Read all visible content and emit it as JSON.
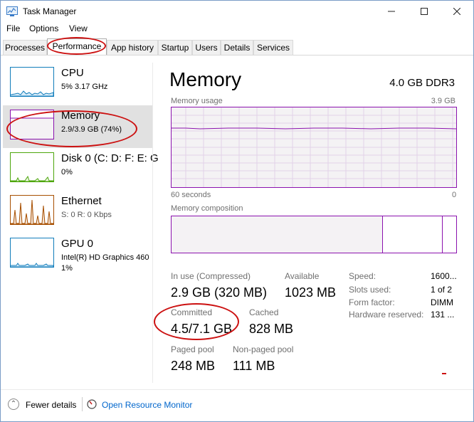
{
  "window": {
    "title": "Task Manager"
  },
  "menu": [
    "File",
    "Options",
    "View"
  ],
  "tabs": [
    "Processes",
    "Performance",
    "App history",
    "Startup",
    "Users",
    "Details",
    "Services"
  ],
  "active_tab": "Performance",
  "resources": [
    {
      "name": "CPU",
      "line1": "5% 3.17 GHz",
      "line2": ""
    },
    {
      "name": "Memory",
      "line1": "2.9/3.9 GB (74%)",
      "line2": ""
    },
    {
      "name": "Disk 0 (C: D: F: E: G",
      "line1": "0%",
      "line2": ""
    },
    {
      "name": "Ethernet",
      "line1": "S: 0 R: 0 Kbps",
      "line2": ""
    },
    {
      "name": "GPU 0",
      "line1": "Intel(R) HD Graphics 460",
      "line2": "1%"
    }
  ],
  "detail": {
    "title": "Memory",
    "spec": "4.0 GB DDR3",
    "usage_label": "Memory usage",
    "usage_max": "3.9 GB",
    "time_left": "60 seconds",
    "time_right": "0",
    "composition_label": "Memory composition",
    "memory_usage_fraction": 0.74,
    "stats": {
      "in_use_label": "In use (Compressed)",
      "in_use_value": "2.9 GB (320 MB)",
      "available_label": "Available",
      "available_value": "1023 MB",
      "committed_label": "Committed",
      "committed_value": "4.5/7.1 GB",
      "cached_label": "Cached",
      "cached_value": "828 MB",
      "paged_label": "Paged pool",
      "paged_value": "248 MB",
      "nonpaged_label": "Non-paged pool",
      "nonpaged_value": "111 MB"
    },
    "specs": [
      {
        "label": "Speed:",
        "value": "1600..."
      },
      {
        "label": "Slots used:",
        "value": "1 of 2"
      },
      {
        "label": "Form factor:",
        "value": "DIMM"
      },
      {
        "label": "Hardware reserved:",
        "value": "131 ..."
      }
    ]
  },
  "footer": {
    "fewer_details": "Fewer details",
    "open_resource_monitor": "Open Resource Monitor"
  },
  "colors": {
    "memory": "#8b12ae",
    "cpu": "#117dbb",
    "disk": "#4da60c",
    "ethernet": "#a74f01",
    "gpu": "#117dbb",
    "annotation": "#cc1111"
  }
}
